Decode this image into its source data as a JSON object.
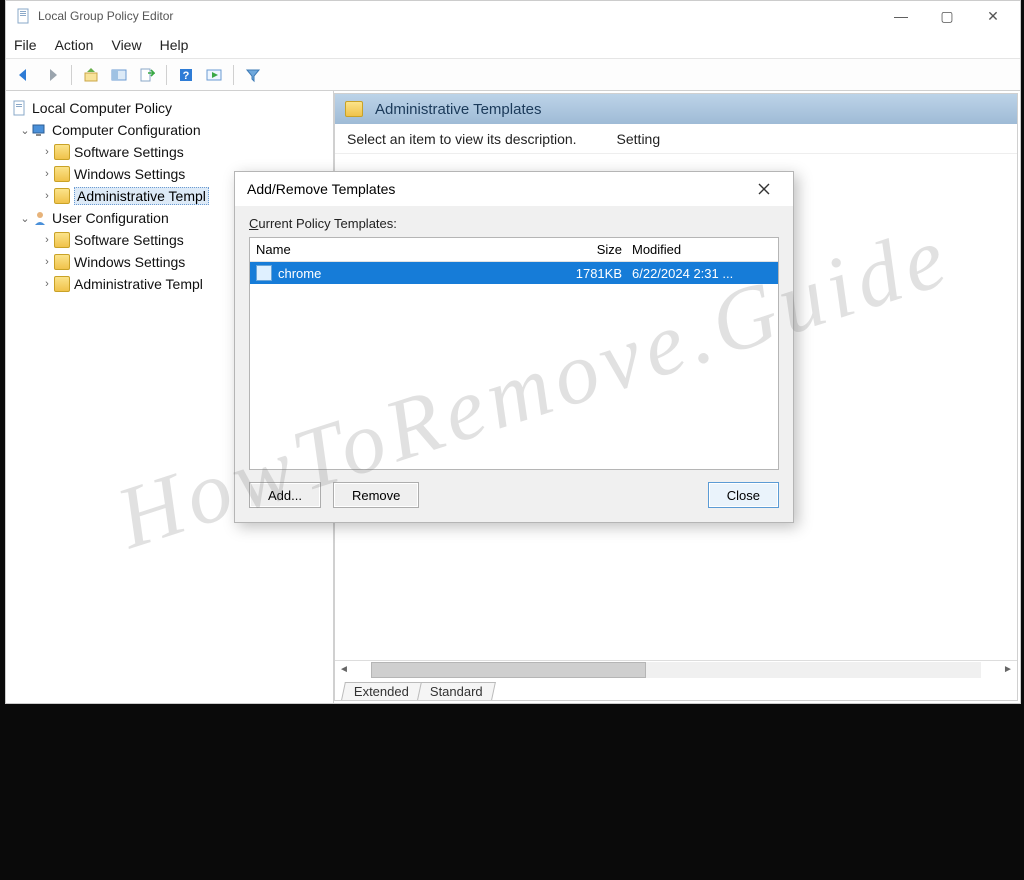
{
  "window": {
    "title": "Local Group Policy Editor",
    "controls": {
      "min": "—",
      "max": "▢",
      "close": "✕"
    }
  },
  "menu": {
    "file": "File",
    "action": "Action",
    "view": "View",
    "help": "Help"
  },
  "tree": {
    "root": "Local Computer Policy",
    "cc": "Computer Configuration",
    "cc_sw": "Software Settings",
    "cc_win": "Windows Settings",
    "cc_adm": "Administrative Templ",
    "uc": "User Configuration",
    "uc_sw": "Software Settings",
    "uc_win": "Windows Settings",
    "uc_adm": "Administrative Templ"
  },
  "pane": {
    "header": "Administrative Templates",
    "hint": "Select an item to view its description.",
    "col_setting": "Setting"
  },
  "tabs": {
    "extended": "Extended",
    "standard": "Standard"
  },
  "dialog": {
    "title": "Add/Remove Templates",
    "label": "Current Policy Templates:",
    "columns": {
      "name": "Name",
      "size": "Size",
      "modified": "Modified"
    },
    "rows": [
      {
        "name": "chrome",
        "size": "1781KB",
        "modified": "6/22/2024 2:31 ..."
      }
    ],
    "buttons": {
      "add": "Add...",
      "remove": "Remove",
      "close": "Close"
    }
  },
  "watermark": "HowToRemove.Guide"
}
